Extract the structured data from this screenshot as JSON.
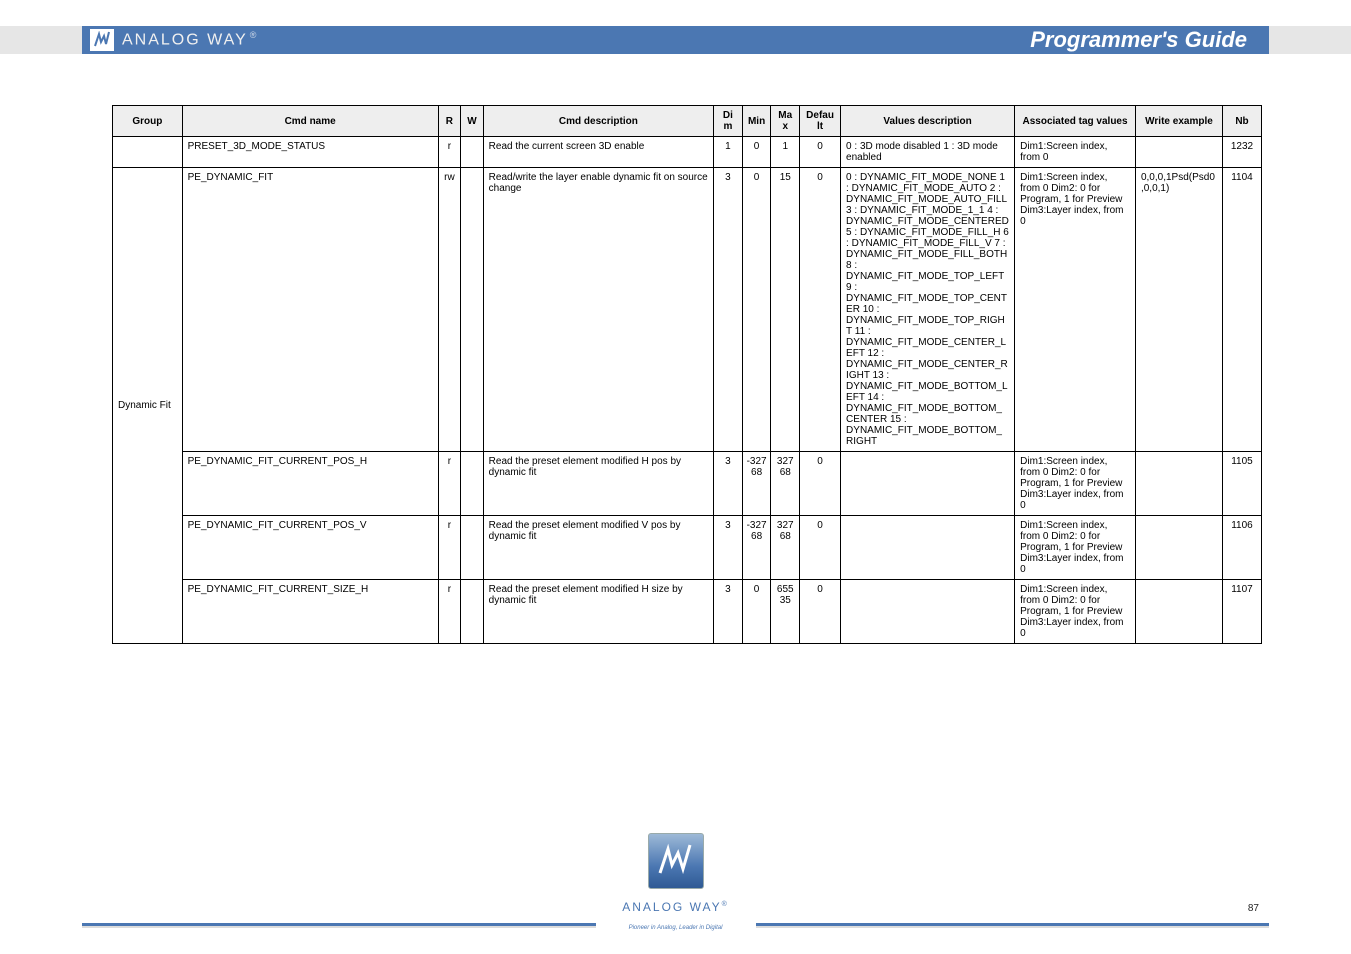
{
  "header": {
    "brand": "ANALOG WAY",
    "title": "Programmer's Guide"
  },
  "table": {
    "columns": [
      "Group",
      "Cmd name",
      "R",
      "W",
      "Cmd description",
      "Dim",
      "Min",
      "Max",
      "Default",
      "Values description",
      "Associated tag values",
      "Write example",
      "Nb"
    ],
    "rows": [
      {
        "group": "",
        "cmd": "PRESET_3D_MODE_STATUS",
        "r": "r",
        "w": "",
        "desc": "Read the current screen 3D enable",
        "dim": "1",
        "min": "0",
        "max": "1",
        "def": "0",
        "values": "0 : 3D mode disabled 1 : 3D mode enabled",
        "tags": "Dim1:Screen index, from 0",
        "ex": "",
        "nb": "1232"
      },
      {
        "group": "Dynamic Fit",
        "cmd": "PE_DYNAMIC_FIT",
        "r": "rw",
        "w": "",
        "desc": "Read/write the layer enable dynamic fit on source change",
        "dim": "3",
        "min": "0",
        "max": "15",
        "def": "0",
        "values": "0 : DYNAMIC_FIT_MODE_NONE 1 : DYNAMIC_FIT_MODE_AUTO 2 : DYNAMIC_FIT_MODE_AUTO_FILL 3 : DYNAMIC_FIT_MODE_1_1 4 : DYNAMIC_FIT_MODE_CENTERED 5 : DYNAMIC_FIT_MODE_FILL_H 6 : DYNAMIC_FIT_MODE_FILL_V 7 : DYNAMIC_FIT_MODE_FILL_BOTH 8 : DYNAMIC_FIT_MODE_TOP_LEFT 9 : DYNAMIC_FIT_MODE_TOP_CENTER 10 : DYNAMIC_FIT_MODE_TOP_RIGHT 11 : DYNAMIC_FIT_MODE_CENTER_LEFT 12 : DYNAMIC_FIT_MODE_CENTER_RIGHT 13 : DYNAMIC_FIT_MODE_BOTTOM_LEFT 14 : DYNAMIC_FIT_MODE_BOTTOM_CENTER 15 : DYNAMIC_FIT_MODE_BOTTOM_RIGHT",
        "tags": "Dim1:Screen index, from 0 Dim2: 0 for Program, 1 for Preview Dim3:Layer index, from 0",
        "ex": "0,0,0,1Psd(Psd0,0,0,1)",
        "nb": "1104"
      },
      {
        "group": "",
        "cmd": "PE_DYNAMIC_FIT_CURRENT_POS_H",
        "r": "r",
        "w": "",
        "desc": "Read the preset element modified H pos by dynamic fit",
        "dim": "3",
        "min": "-32768",
        "max": "32768",
        "def": "0",
        "values": "",
        "tags": "Dim1:Screen index, from 0 Dim2: 0 for Program, 1 for Preview Dim3:Layer index, from 0",
        "ex": "",
        "nb": "1105"
      },
      {
        "group": "",
        "cmd": "PE_DYNAMIC_FIT_CURRENT_POS_V",
        "r": "r",
        "w": "",
        "desc": "Read the preset element modified V pos by dynamic fit",
        "dim": "3",
        "min": "-32768",
        "max": "32768",
        "def": "0",
        "values": "",
        "tags": "Dim1:Screen index, from 0 Dim2: 0 for Program, 1 for Preview Dim3:Layer index, from 0",
        "ex": "",
        "nb": "1106"
      },
      {
        "group": "",
        "cmd": "PE_DYNAMIC_FIT_CURRENT_SIZE_H",
        "r": "r",
        "w": "",
        "desc": "Read the preset element modified H size by dynamic fit",
        "dim": "3",
        "min": "0",
        "max": "65535",
        "def": "0",
        "values": "",
        "tags": "Dim1:Screen index, from 0 Dim2: 0 for Program, 1 for Preview Dim3:Layer index, from 0",
        "ex": "",
        "nb": "1107"
      }
    ]
  },
  "footer": {
    "brand": "ANALOG WAY",
    "tagline": "Pioneer in Analog, Leader in Digital",
    "page": "87"
  }
}
